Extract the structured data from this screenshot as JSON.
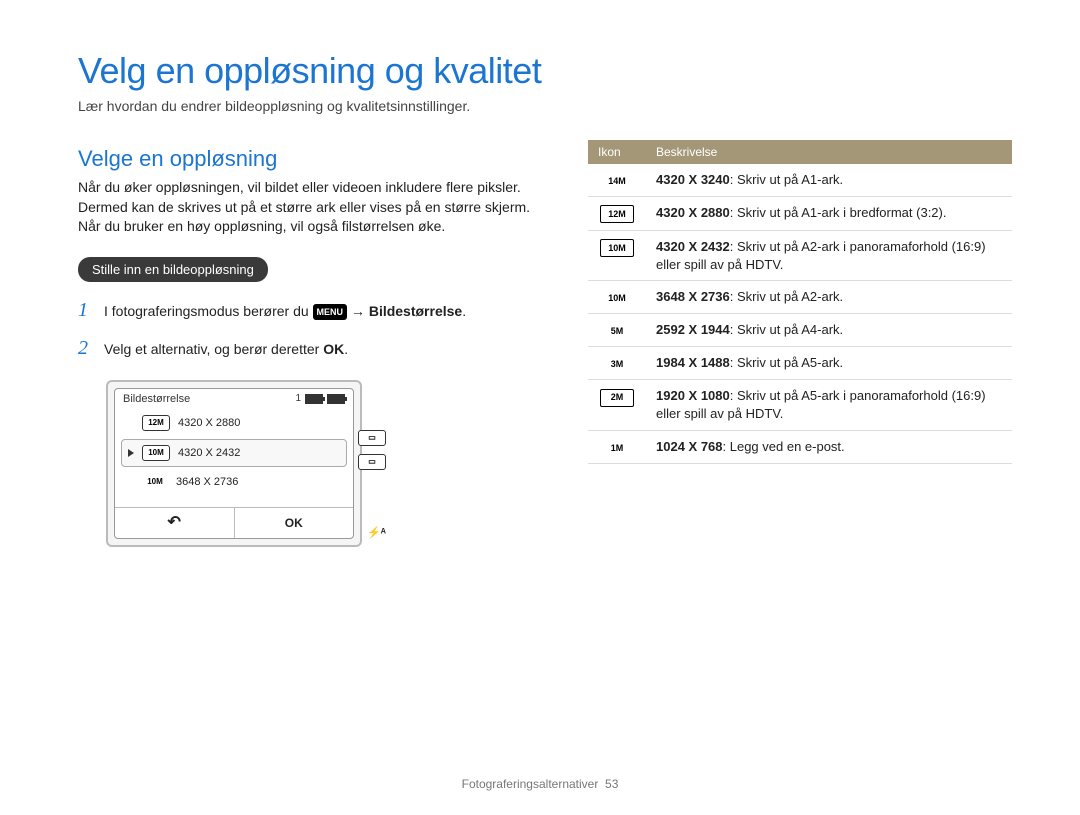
{
  "title": "Velg en oppløsning og kvalitet",
  "subtitle": "Lær hvordan du endrer bildeoppløsning og kvalitetsinnstillinger.",
  "left": {
    "heading": "Velge en oppløsning",
    "paragraph": "Når du øker oppløsningen, vil bildet eller videoen inkludere flere piksler. Dermed kan de skrives ut på et større ark eller vises på en større skjerm. Når du bruker en høy oppløsning, vil også filstørrelsen øke.",
    "pill": "Stille inn en bildeoppløsning",
    "step1_num": "1",
    "step1_pre": "I fotograferingsmodus berører du ",
    "step1_menu_icon": "MENU",
    "step1_arrow": " → ",
    "step1_bold": "Bildestørrelse",
    "step1_post": ".",
    "step2_num": "2",
    "step2_pre": "Velg et alternativ, og berør deretter ",
    "step2_ok": "OK",
    "step2_post": "."
  },
  "cam": {
    "title": "Bildestørrelse",
    "count": "1",
    "rows": [
      {
        "icon_label": "12M",
        "framed": true,
        "label": "4320 X 2880"
      },
      {
        "icon_label": "10M",
        "framed": true,
        "label": "4320 X 2432",
        "selected": true
      },
      {
        "icon_label": "10M",
        "framed": false,
        "label": "3648 X 2736"
      }
    ],
    "back_label": "↶",
    "ok_label": "OK",
    "flash_label": "⚡ᴬ"
  },
  "table": {
    "head_icon": "Ikon",
    "head_desc": "Beskrivelse",
    "rows": [
      {
        "icon_label": "14M",
        "framed": false,
        "bold": "4320 X 3240",
        "desc": ": Skriv ut på A1-ark."
      },
      {
        "icon_label": "12M",
        "framed": true,
        "bold": "4320 X 2880",
        "desc": ": Skriv ut på A1-ark i bredformat (3:2)."
      },
      {
        "icon_label": "10M",
        "framed": true,
        "bold": "4320 X 2432",
        "desc": ": Skriv ut på A2-ark i panoramaforhold (16:9) eller spill av på HDTV."
      },
      {
        "icon_label": "10M",
        "framed": false,
        "bold": "3648 X 2736",
        "desc": ": Skriv ut på A2-ark."
      },
      {
        "icon_label": "5M",
        "framed": false,
        "bold": "2592 X 1944",
        "desc": ": Skriv ut på A4-ark."
      },
      {
        "icon_label": "3M",
        "framed": false,
        "bold": "1984 X 1488",
        "desc": ": Skriv ut på A5-ark."
      },
      {
        "icon_label": "2M",
        "framed": true,
        "bold": "1920 X 1080",
        "desc": ": Skriv ut på A5-ark i panoramaforhold (16:9) eller spill av på HDTV."
      },
      {
        "icon_label": "1M",
        "framed": false,
        "bold": "1024 X 768",
        "desc": ": Legg ved en e-post."
      }
    ]
  },
  "footer": {
    "section": "Fotograferingsalternativer",
    "page": "53"
  }
}
